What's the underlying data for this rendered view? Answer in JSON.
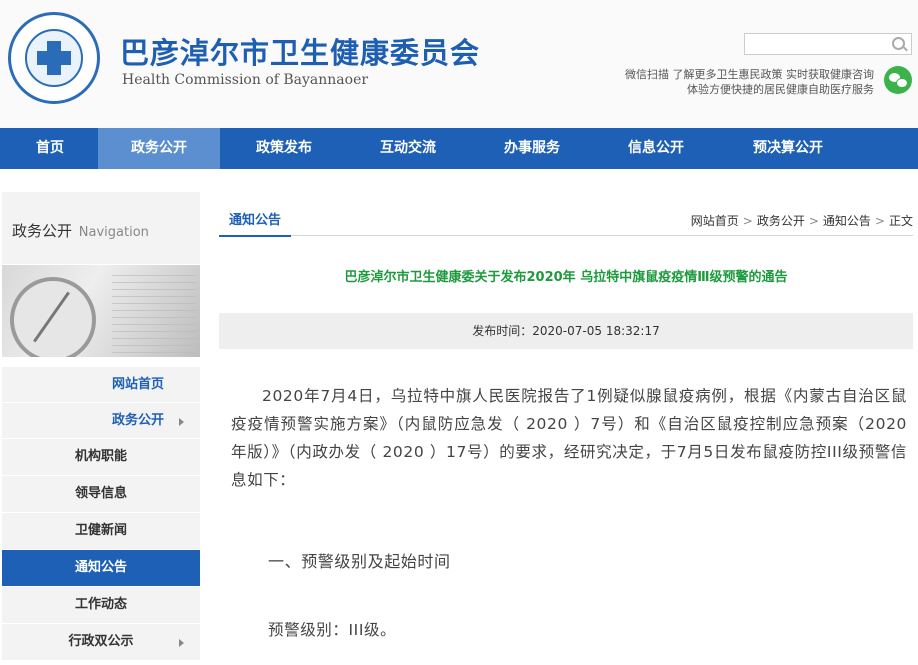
{
  "header": {
    "title": "巴彦淖尔市卫生健康委员会",
    "subtitle": "Health Commission of Bayannaoer",
    "search_placeholder": "",
    "wechat_line1": "微信扫描 了解更多卫生惠民政策 实时获取健康咨询",
    "wechat_line2": "体验方便快捷的居民健康自助医疗服务"
  },
  "nav": [
    {
      "label": "首页"
    },
    {
      "label": "政务公开"
    },
    {
      "label": "政策发布"
    },
    {
      "label": "互动交流"
    },
    {
      "label": "办事服务"
    },
    {
      "label": "信息公开"
    },
    {
      "label": "预决算公开"
    }
  ],
  "sidebar": {
    "heading": "政务公开",
    "heading_en": "Navigation",
    "items": [
      {
        "label": "网站首页"
      },
      {
        "label": "政务公开"
      },
      {
        "label": "机构职能"
      },
      {
        "label": "领导信息"
      },
      {
        "label": "卫健新闻"
      },
      {
        "label": "通知公告"
      },
      {
        "label": "工作动态"
      },
      {
        "label": "行政双公示"
      }
    ]
  },
  "content": {
    "section_label": "通知公告",
    "breadcrumb": [
      "网站首页",
      "政务公开",
      "通知公告",
      "正文"
    ],
    "breadcrumb_sep": ">",
    "title": "巴彦淖尔市卫生健康委关于发布2020年 乌拉特中旗鼠疫疫情Ⅲ级预警的通告",
    "publish_time": "发布时间：2020-07-05 18:32:17",
    "paragraph1": "2020年7月4日，乌拉特中旗人民医院报告了1例疑似腺鼠疫病例，根据《内蒙古自治区鼠疫疫情预警实施方案》（内鼠防应急发（ 2020 ）7号）和《自治区鼠疫控制应急预案（2020年版）》（内政办发（ 2020 ）17号）的要求，经研究决定，于7月5日发布鼠疫防控III级预警信息如下：",
    "section1_title": "一、预警级别及起始时间",
    "warning_level": "预警级别：III级。"
  },
  "colors": {
    "brand_blue": "#1e60b5",
    "title_green": "#1e9a3e",
    "wechat_green": "#3bb34a"
  }
}
